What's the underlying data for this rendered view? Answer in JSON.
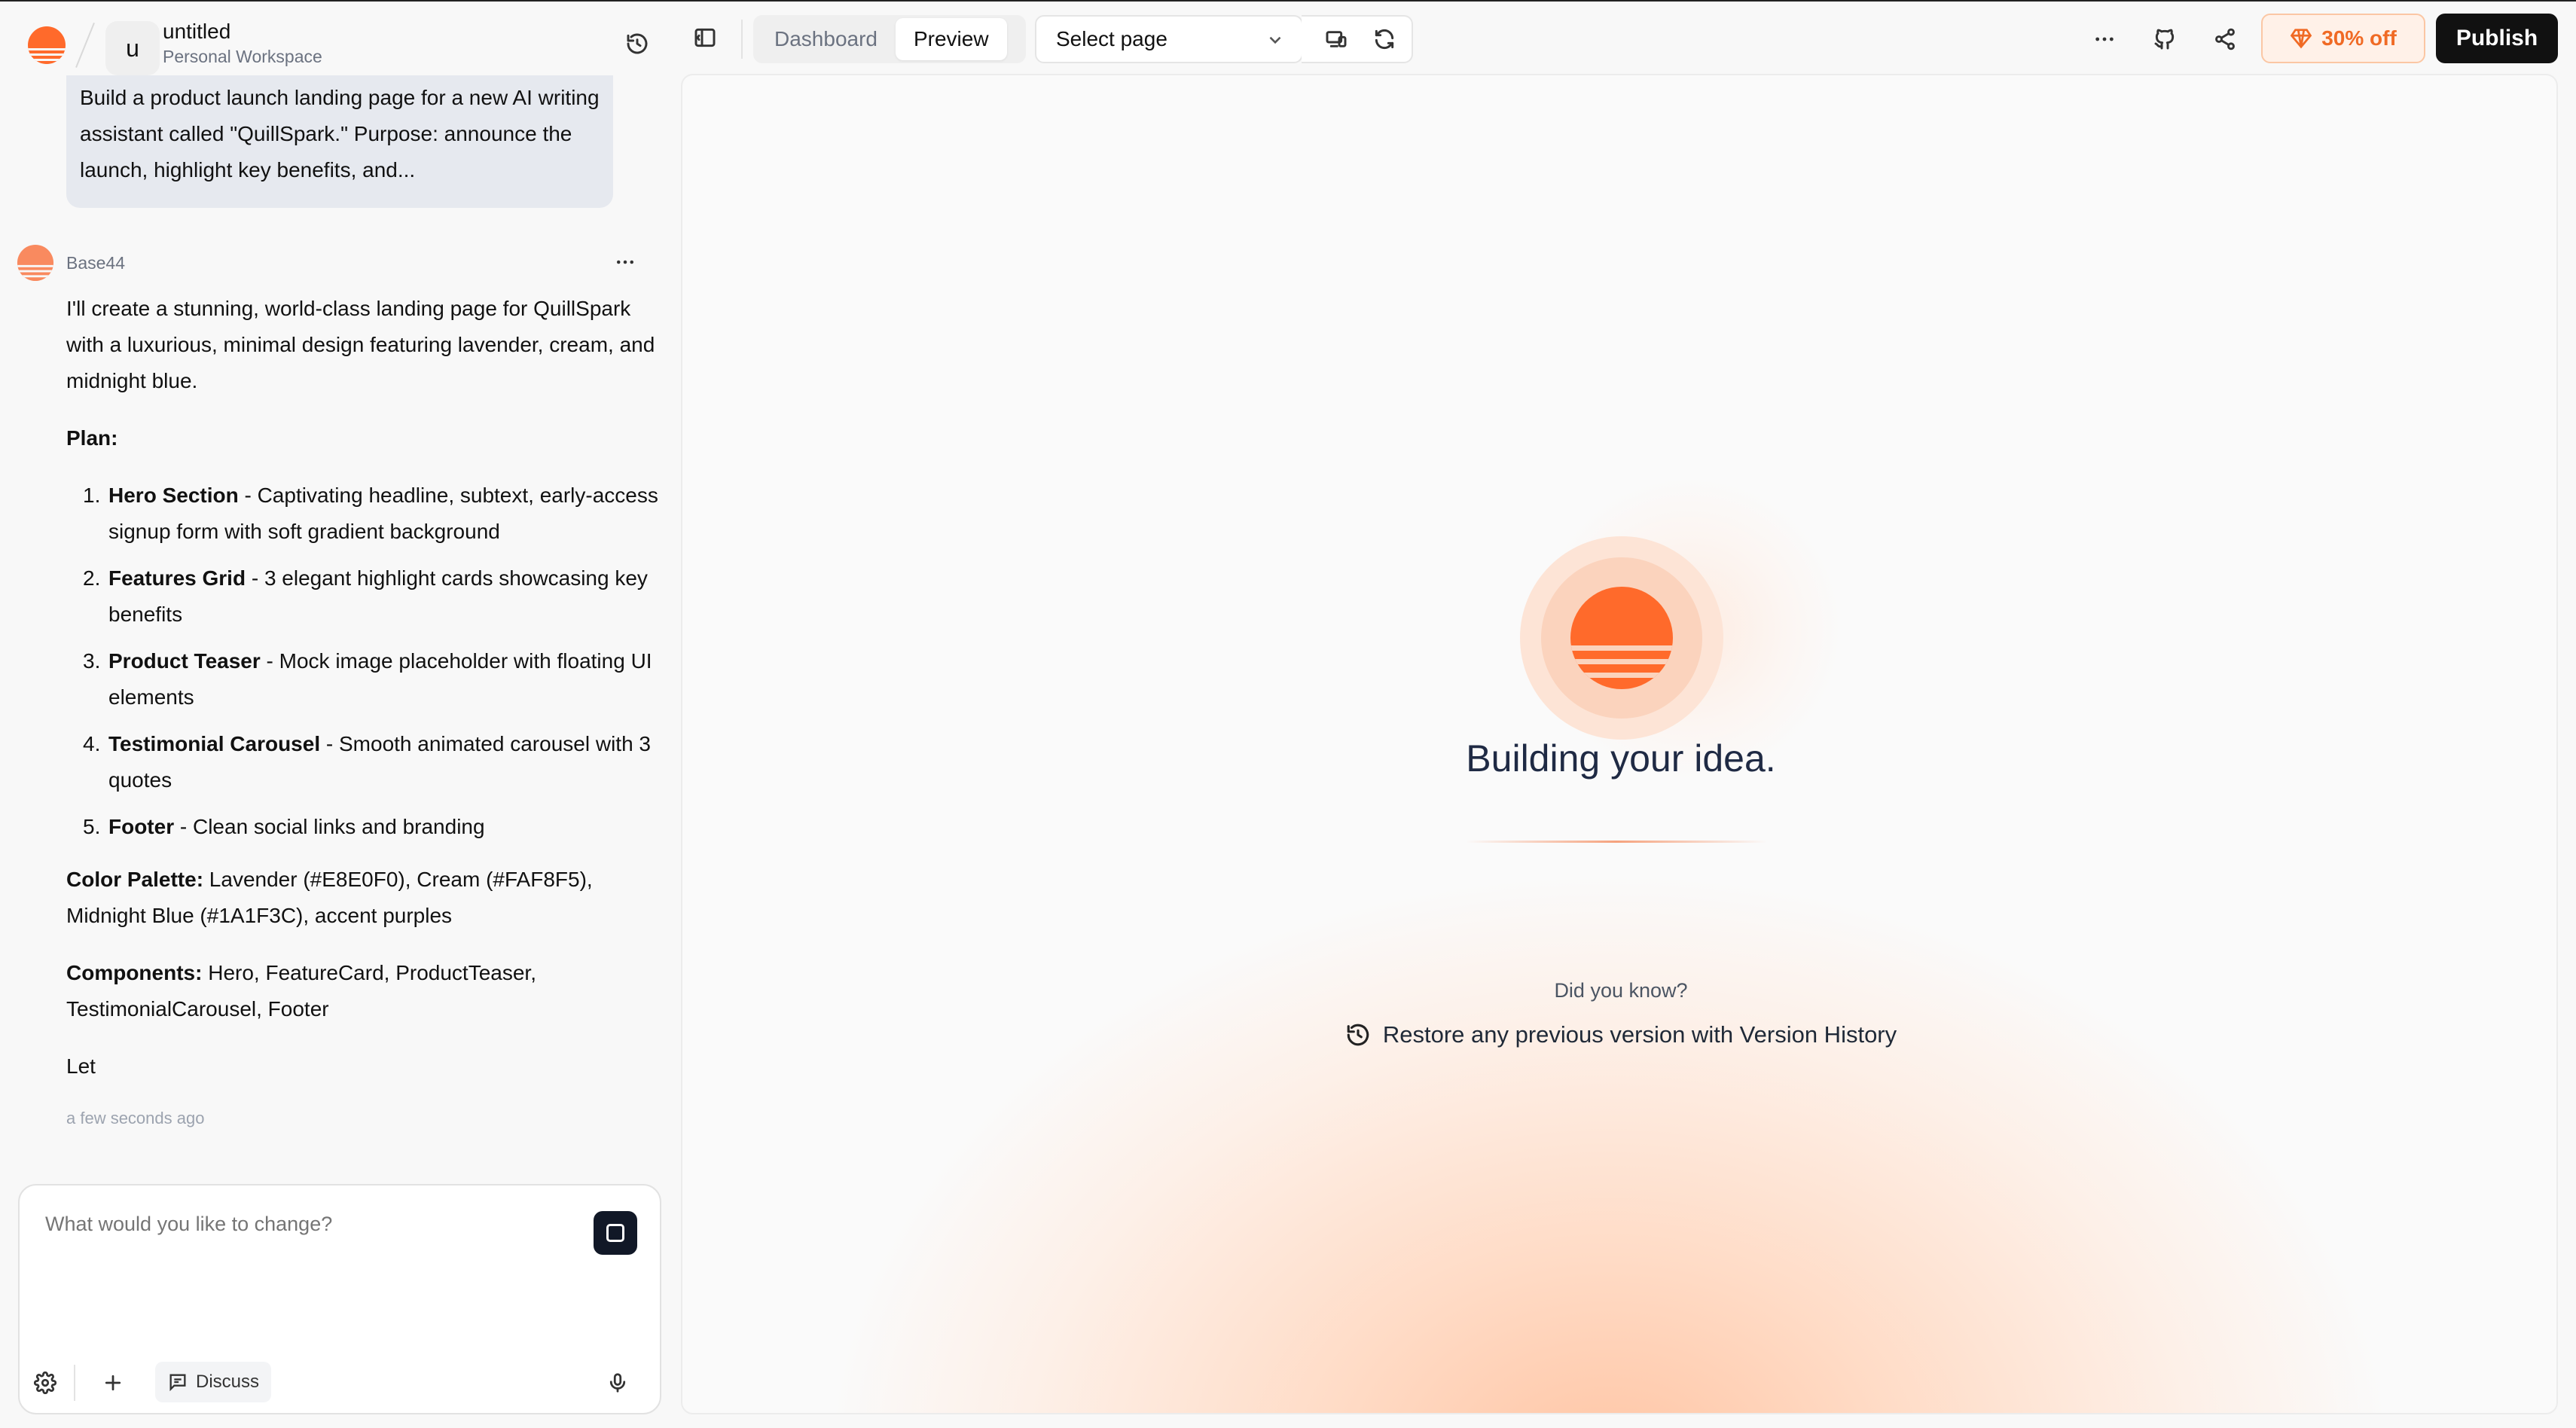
{
  "workspace": {
    "avatar_letter": "u",
    "title": "untitled",
    "subtitle": "Personal Workspace"
  },
  "toolbar": {
    "tabs": [
      {
        "label": "Dashboard",
        "active": false
      },
      {
        "label": "Preview",
        "active": true
      }
    ],
    "page_select": "Select page",
    "discount_label": "30% off",
    "publish_label": "Publish"
  },
  "chat": {
    "user_message": "Build a product launch landing page for a new AI writing assistant called \"QuillSpark.\" Purpose: announce the launch, highlight key benefits, and...",
    "bot_name": "Base44",
    "intro": "I'll create a stunning, world-class landing page for QuillSpark with a luxurious, minimal design featuring lavender, cream, and midnight blue.",
    "plan_heading": "Plan:",
    "plan": [
      {
        "num": "1.",
        "title": "Hero Section",
        "desc": " - Captivating headline, subtext, early-access signup form with soft gradient background"
      },
      {
        "num": "2.",
        "title": "Features Grid",
        "desc": " - 3 elegant highlight cards showcasing key benefits"
      },
      {
        "num": "3.",
        "title": "Product Teaser",
        "desc": " - Mock image placeholder with floating UI elements"
      },
      {
        "num": "4.",
        "title": "Testimonial Carousel",
        "desc": " - Smooth animated carousel with 3 quotes"
      },
      {
        "num": "5.",
        "title": "Footer",
        "desc": " - Clean social links and branding"
      }
    ],
    "palette_label": "Color Palette:",
    "palette_text": " Lavender (#E8E0F0), Cream (#FAF8F5), Midnight Blue (#1A1F3C), accent purples",
    "components_label": "Components:",
    "components_text": " Hero, FeatureCard, ProductTeaser, TestimonialCarousel, Footer",
    "partial": "Let",
    "timestamp": "a few seconds ago"
  },
  "composer": {
    "placeholder": "What would you like to change?",
    "discuss_label": "Discuss"
  },
  "preview": {
    "status": "Building your idea.",
    "did_you_know": "Did you know?",
    "tip": "Restore any previous version with Version History"
  },
  "colors": {
    "brand_orange": "#FF6A2B",
    "publish_bg": "#111111",
    "discount_text": "#F06A24"
  },
  "icons": [
    "logo-icon",
    "history-icon",
    "sidebar-toggle-icon",
    "chevron-down-icon",
    "device-icon",
    "refresh-icon",
    "more-icon",
    "github-icon",
    "share-icon",
    "gem-icon",
    "settings-icon",
    "plus-icon",
    "chat-icon",
    "mic-icon",
    "stop-icon"
  ]
}
